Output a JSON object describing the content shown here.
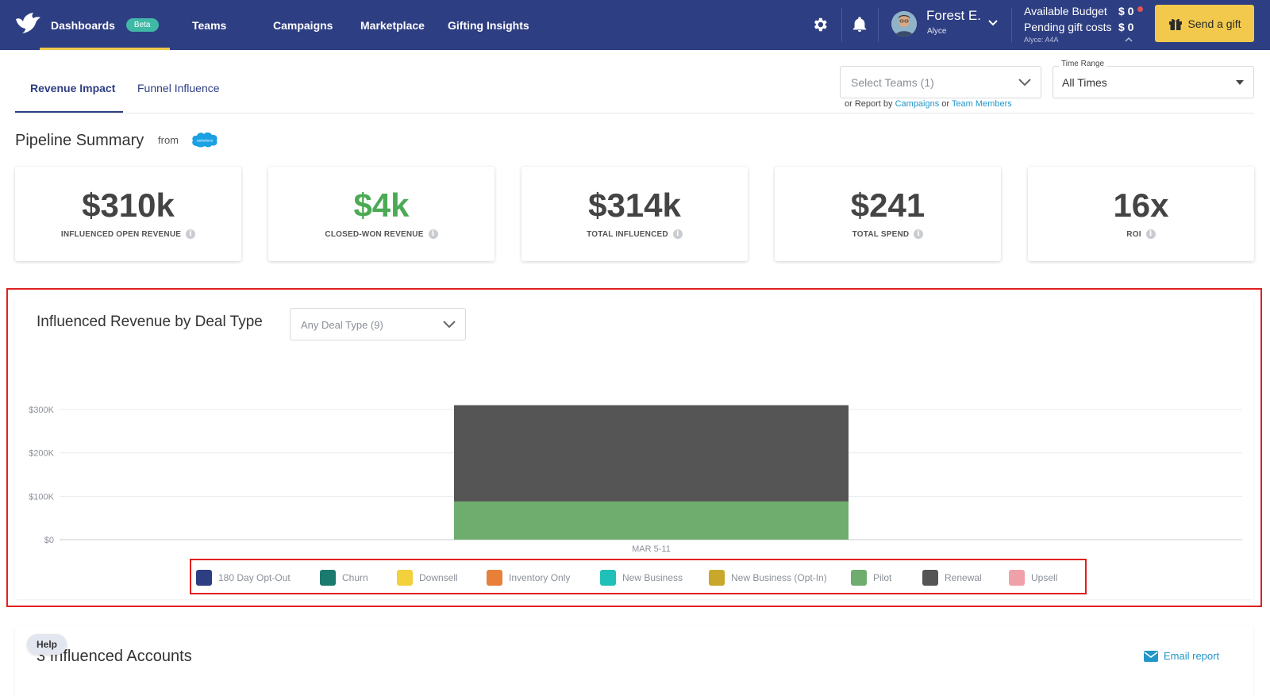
{
  "nav": {
    "items": [
      {
        "label": "Dashboards",
        "badge": "Beta",
        "active": true
      },
      {
        "label": "Teams"
      },
      {
        "label": "Campaigns"
      },
      {
        "label": "Marketplace"
      },
      {
        "label": "Gifting Insights"
      }
    ],
    "icons": [
      "settings-icon",
      "bell-icon"
    ],
    "user": {
      "name": "Forest E.",
      "org": "Alyce"
    },
    "budget": {
      "available_label": "Available Budget",
      "available_value": "$ 0",
      "pending_label": "Pending gift costs",
      "pending_value": "$ 0",
      "org": "Alyce: A4A"
    },
    "send_gift": "Send a gift"
  },
  "tabs": [
    {
      "label": "Revenue Impact",
      "active": true
    },
    {
      "label": "Funnel Influence"
    }
  ],
  "filters": {
    "teams_placeholder": "Select Teams (1)",
    "report_by_prefix": "or Report by",
    "report_by_campaigns": "Campaigns",
    "report_by_or": "or",
    "report_by_members": "Team Members",
    "time_range_label": "Time Range",
    "time_range_value": "All Times"
  },
  "pipeline": {
    "title": "Pipeline Summary",
    "from": "from",
    "source_logo": "salesforce",
    "kpis": [
      {
        "value": "$310k",
        "label": "INFLUENCED OPEN REVENUE"
      },
      {
        "value": "$4k",
        "label": "CLOSED-WON REVENUE",
        "color": "#4caa55"
      },
      {
        "value": "$314k",
        "label": "TOTAL INFLUENCED"
      },
      {
        "value": "$241",
        "label": "TOTAL SPEND"
      },
      {
        "value": "16x",
        "label": "ROI"
      }
    ]
  },
  "revenue_chart": {
    "title": "Influenced Revenue by Deal Type",
    "deal_type_select": "Any Deal Type (9)"
  },
  "chart_data": {
    "type": "bar",
    "stacked": true,
    "categories": [
      "MAR 5-11"
    ],
    "y_ticks": [
      "$0",
      "$100K",
      "$200K",
      "$300K"
    ],
    "ylim": [
      0,
      310000
    ],
    "grid": true,
    "legend_position": "bottom",
    "series": [
      {
        "name": "180 Day Opt-Out",
        "color": "#2e3e82",
        "values": [
          0
        ]
      },
      {
        "name": "Churn",
        "color": "#1a7a6e",
        "values": [
          0
        ]
      },
      {
        "name": "Downsell",
        "color": "#f2d13c",
        "values": [
          0
        ]
      },
      {
        "name": "Inventory Only",
        "color": "#e8803a",
        "values": [
          0
        ]
      },
      {
        "name": "New Business",
        "color": "#1fc0b8",
        "values": [
          0
        ]
      },
      {
        "name": "New Business (Opt-In)",
        "color": "#c8a82a",
        "values": [
          0
        ]
      },
      {
        "name": "Pilot",
        "color": "#6ead6e",
        "values": [
          88000
        ]
      },
      {
        "name": "Renewal",
        "color": "#555555",
        "values": [
          222000
        ]
      },
      {
        "name": "Upsell",
        "color": "#f0a0a8",
        "values": [
          0
        ]
      }
    ]
  },
  "accounts": {
    "title": "3 Influenced Accounts",
    "email_report": "Email report"
  },
  "help": "Help"
}
